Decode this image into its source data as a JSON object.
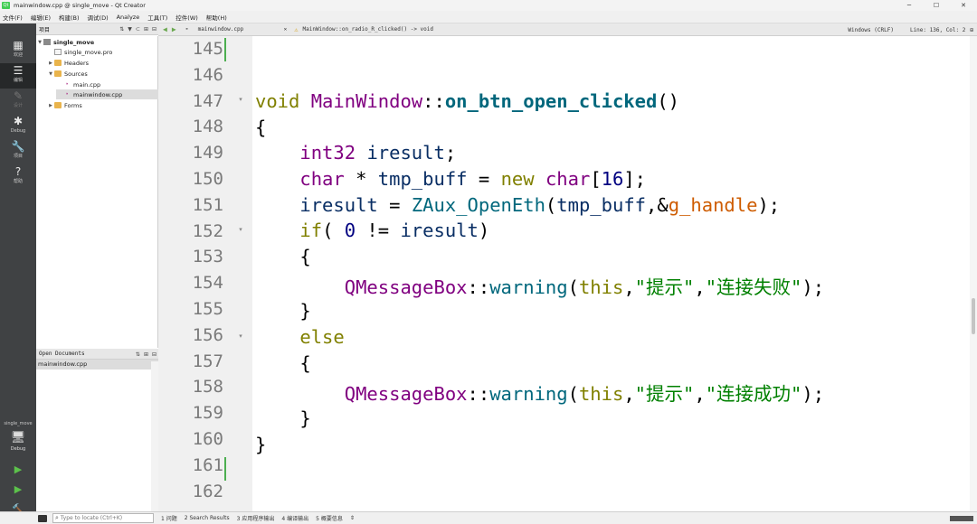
{
  "window": {
    "title": "mainwindow.cpp @ single_move - Qt Creator",
    "app_icon_text": "Qt",
    "controls": [
      "─",
      "☐",
      "✕"
    ]
  },
  "menu": [
    "文件(F)",
    "编辑(E)",
    "构建(B)",
    "调试(D)",
    "Analyze",
    "工具(T)",
    "控件(W)",
    "帮助(H)"
  ],
  "modes": [
    {
      "label": "欢迎",
      "icon": "grid-icon",
      "glyph": "▦"
    },
    {
      "label": "编辑",
      "icon": "edit-icon",
      "glyph": "☰"
    },
    {
      "label": "设计",
      "icon": "pen-icon",
      "glyph": "✎"
    },
    {
      "label": "Debug",
      "icon": "bug-icon",
      "glyph": "✱"
    },
    {
      "label": "项目",
      "icon": "wrench-icon",
      "glyph": "🔧"
    },
    {
      "label": "帮助",
      "icon": "help-icon",
      "glyph": "?"
    }
  ],
  "kit": {
    "project": "single_move",
    "label": "Debug",
    "icon": "monitor-icon",
    "glyph": "🖥"
  },
  "run": {
    "run_glyph": "▶",
    "debug_glyph": "▶",
    "build_glyph": "🔨"
  },
  "projects_pane": {
    "title": "项目",
    "tools": [
      "⇅",
      "▼",
      "⊂",
      "⊞",
      "⊟"
    ],
    "items": [
      {
        "label": "single_move",
        "level": 0,
        "expanded": true,
        "icon": "project-icon",
        "bold": true
      },
      {
        "label": "single_move.pro",
        "level": 1,
        "icon": "pro-file-icon"
      },
      {
        "label": "Headers",
        "level": 1,
        "expanded": false,
        "icon": "folder-icon"
      },
      {
        "label": "Sources",
        "level": 1,
        "expanded": true,
        "icon": "folder-icon"
      },
      {
        "label": "main.cpp",
        "level": 2,
        "icon": "cpp-file-icon"
      },
      {
        "label": "mainwindow.cpp",
        "level": 2,
        "icon": "cpp-file-icon",
        "selected": true
      },
      {
        "label": "Forms",
        "level": 1,
        "expanded": false,
        "icon": "folder-icon"
      }
    ]
  },
  "open_documents": {
    "title": "Open Documents",
    "tools": [
      "⇅",
      "⊞",
      "⊟"
    ],
    "items": [
      "mainwindow.cpp"
    ]
  },
  "editor_toolbar": {
    "back": "◀",
    "forward": "▶",
    "file": "mainwindow.cpp",
    "close": "✕",
    "warning_glyph": "⚠",
    "symbol": "MainWindow::on_radio_R_clicked() -> void",
    "line_endings": "Windows (CRLF)",
    "position": "Line: 136, Col: 2",
    "split": "⊞"
  },
  "editor": {
    "lines": [
      145,
      146,
      147,
      148,
      149,
      150,
      151,
      152,
      153,
      154,
      155,
      156,
      157,
      158,
      159,
      160,
      161,
      162
    ],
    "fold_markers": [
      147,
      152,
      156
    ],
    "modified_lines": [
      145,
      161
    ],
    "code": {
      "l147": {
        "kw": "void",
        "cls": "MainWindow",
        "sep": "::",
        "fn": "on_btn_open_clicked",
        "tail": "()"
      },
      "l148": "{",
      "l149": {
        "ty": "int32",
        "var": "iresult",
        "tail": ";"
      },
      "l150": {
        "ty": "char",
        "op": " * ",
        "var": "tmp_buff",
        "eq": " = ",
        "kw": "new",
        "ty2": "char",
        "open": "[",
        "num": "16",
        "close": "];"
      },
      "l151": {
        "var": "iresult",
        "eq": " = ",
        "fn": "ZAux_OpenEth",
        "open": "(",
        "arg1": "tmp_buff",
        "comma": ",&",
        "glob": "g_handle",
        "close": ");"
      },
      "l152": {
        "kw": "if",
        "open": "( ",
        "num": "0",
        "op": " != ",
        "var": "iresult",
        "close": ")"
      },
      "l153": "{",
      "l154": {
        "cls": "QMessageBox",
        "sep": "::",
        "fn": "warning",
        "open": "(",
        "this": "this",
        "comma": ",",
        "s1": "\"提示\"",
        "comma2": ",",
        "s2": "\"连接失败\"",
        "close": ");"
      },
      "l155": "}",
      "l156": {
        "kw": "else"
      },
      "l157": "{",
      "l158": {
        "cls": "QMessageBox",
        "sep": "::",
        "fn": "warning",
        "open": "(",
        "this": "this",
        "comma": ",",
        "s1": "\"提示\"",
        "comma2": ",",
        "s2": "\"连接成功\"",
        "close": ");"
      },
      "l159": "}",
      "l160": "}"
    }
  },
  "status": {
    "locator_placeholder": "Type to locate (Ctrl+K)",
    "search_glyph": "⌕",
    "panels": [
      "1 问题",
      "2 Search Results",
      "3 应用程序输出",
      "4 编译输出",
      "5 概要信息",
      "⇕"
    ]
  }
}
